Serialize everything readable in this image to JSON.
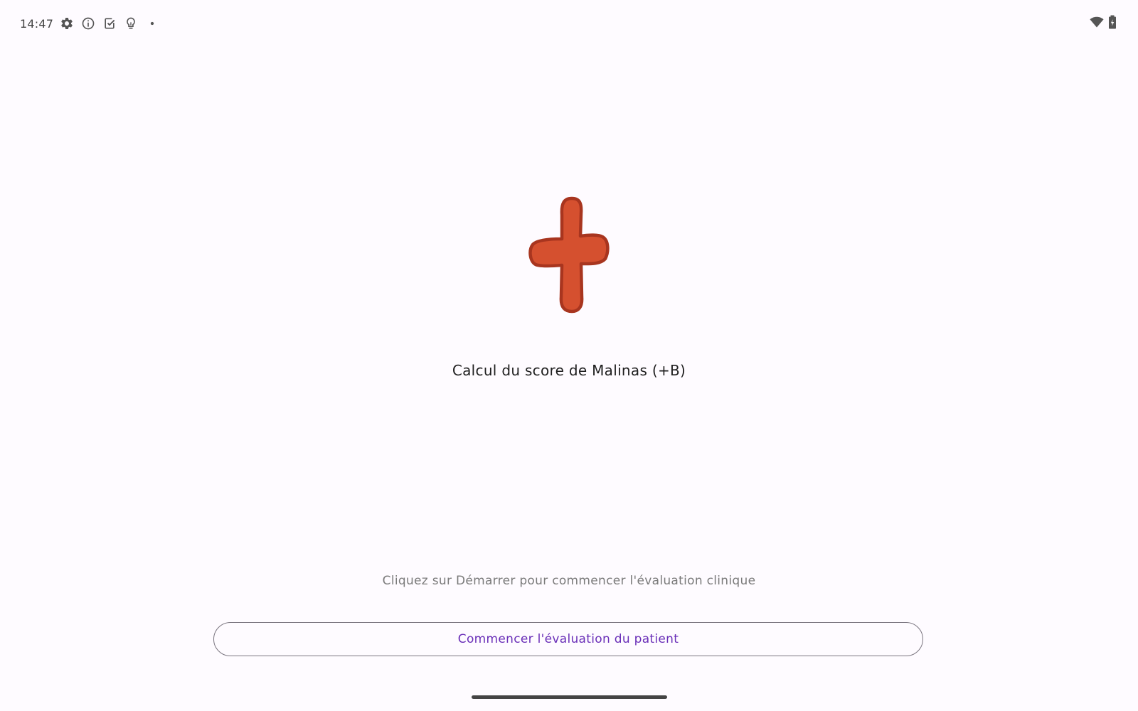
{
  "status_bar": {
    "time": "14:47",
    "left_icons": [
      "gear-icon",
      "info-icon",
      "task-check-icon",
      "lightbulb-icon",
      "dot-icon"
    ],
    "right_icons": [
      "wifi-icon",
      "battery-icon"
    ]
  },
  "main": {
    "logo_icon": "red-cross-icon",
    "title": "Calcul du score de Malinas (+B)",
    "hint": "Cliquez sur Démarrer pour commencer l'évaluation clinique",
    "start_button_label": "Commencer l'évaluation du patient"
  },
  "colors": {
    "background": "#fefbff",
    "accent": "#6a2fb8",
    "logo_fill": "#d5502f",
    "logo_stroke": "#a8351f"
  }
}
